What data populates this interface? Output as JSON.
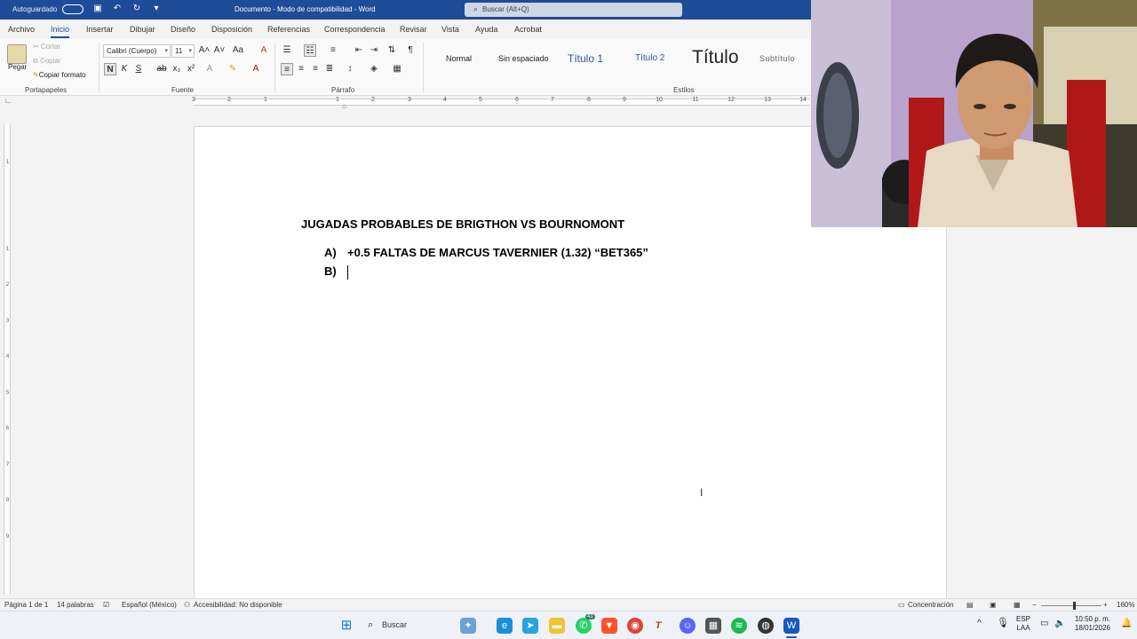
{
  "titlebar": {
    "autosave": "Autoguardado",
    "doc_title": "Documento  -  Modo de compatibilidad  -  Word",
    "search_placeholder": "Buscar (Alt+Q)"
  },
  "tabs": [
    "Archivo",
    "Inicio",
    "Insertar",
    "Dibujar",
    "Diseño",
    "Disposición",
    "Referencias",
    "Correspondencia",
    "Revisar",
    "Vista",
    "Ayuda",
    "Acrobat"
  ],
  "active_tab": "Inicio",
  "clipboard": {
    "paste": "Pegar",
    "cut": "Cortar",
    "copy": "Copiar",
    "format_painter": "Copiar formato",
    "label": "Portapapeles"
  },
  "font": {
    "name": "Calibri (Cuerpo)",
    "size": "11",
    "label": "Fuente",
    "bold": "N",
    "italic": "K",
    "underline": "S"
  },
  "paragraph": {
    "label": "Párrafo"
  },
  "styles": {
    "label": "Estilos",
    "items": [
      "Normal",
      "Sin espaciado",
      "Título 1",
      "Título 2",
      "Título",
      "Subtítulo"
    ]
  },
  "ruler_numbers": [
    "3",
    "2",
    "1",
    "1",
    "2",
    "3",
    "4",
    "5",
    "6",
    "7",
    "8",
    "9",
    "10",
    "11",
    "12",
    "13",
    "14"
  ],
  "vruler_numbers": [
    "1",
    "1",
    "2",
    "3",
    "4",
    "5",
    "6",
    "7",
    "8",
    "9"
  ],
  "document": {
    "title": "JUGADAS PROBABLES DE BRIGTHON VS BOURNOMONT",
    "items": [
      {
        "marker": "A)",
        "text": "+0.5 FALTAS DE MARCUS TAVERNIER (1.32) “BET365”"
      },
      {
        "marker": "B)",
        "text": ""
      }
    ]
  },
  "statusbar": {
    "page": "Página 1 de 1",
    "words": "14 palabras",
    "language": "Español (México)",
    "accessibility": "Accesibilidad: No disponible",
    "focus": "Concentración",
    "zoom": "160%"
  },
  "taskbar": {
    "search": "Buscar",
    "badge": "41",
    "lang_top": "ESP",
    "lang_bottom": "LAA",
    "time": "10:50 p. m.",
    "date": "18/01/2026"
  },
  "colors": {
    "title_bar": "#1e4c99",
    "accent": "#1e4c99",
    "page": "#ffffff"
  }
}
